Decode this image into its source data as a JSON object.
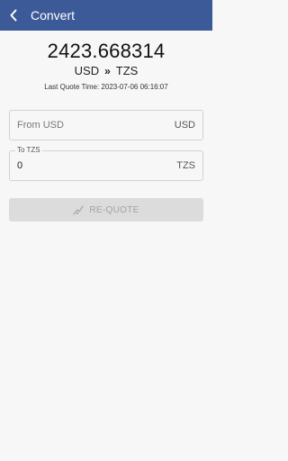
{
  "appbar": {
    "title": "Convert",
    "back_icon": "chevron-left-icon"
  },
  "quote": {
    "rate": "2423.668314",
    "from_currency": "USD",
    "arrows": "»",
    "to_currency": "TZS",
    "time_text": "Last Quote Time: 2023-07-06 06:16:07"
  },
  "from_field": {
    "placeholder": "From USD",
    "unit": "USD"
  },
  "to_field": {
    "label": "To TZS",
    "value": "0",
    "unit": "TZS"
  },
  "requote_button": {
    "label": "RE-QUOTE",
    "icon": "refresh-signal-icon"
  },
  "colors": {
    "appbar": "#3d5a98",
    "background": "#f7f7f7",
    "button_disabled": "#dcdcdc"
  }
}
